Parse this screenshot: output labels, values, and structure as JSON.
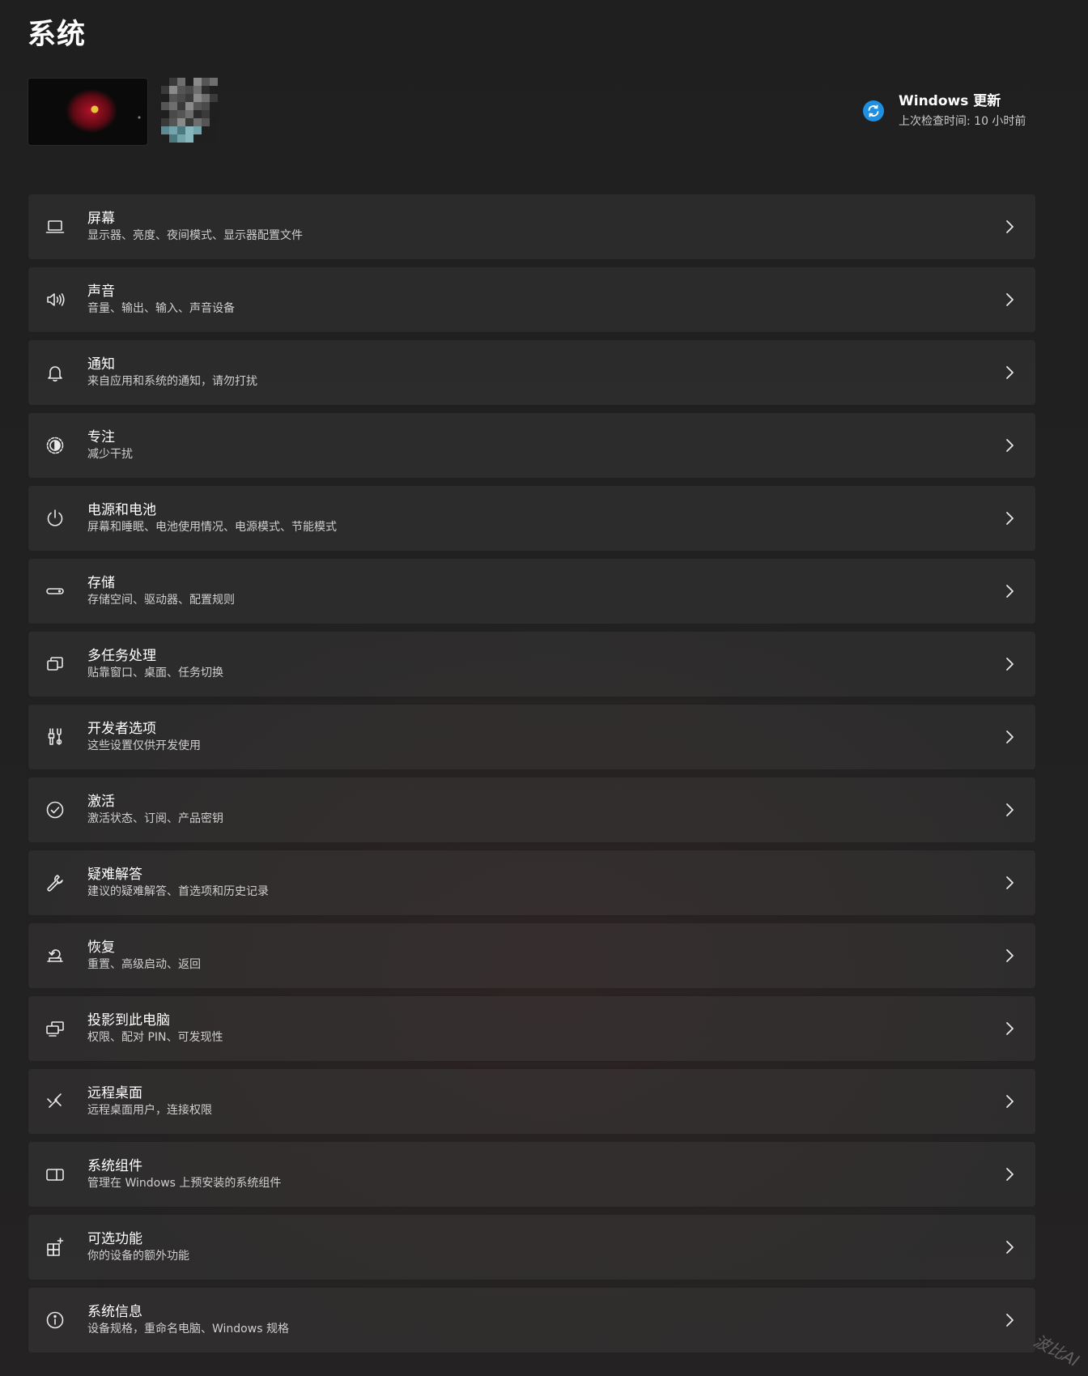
{
  "page": {
    "title": "系统"
  },
  "profile": {
    "avatar_icon": "avatar-image"
  },
  "update": {
    "title": "Windows 更新",
    "subtitle": "上次检查时间: 10 小时前",
    "icon": "sync-icon",
    "accent": "#1e8fe1"
  },
  "items": [
    {
      "title": "屏幕",
      "subtitle": "显示器、亮度、夜间模式、显示器配置文件",
      "icon": "laptop-icon"
    },
    {
      "title": "声音",
      "subtitle": "音量、输出、输入、声音设备",
      "icon": "speaker-icon"
    },
    {
      "title": "通知",
      "subtitle": "来自应用和系统的通知，请勿打扰",
      "icon": "bell-icon"
    },
    {
      "title": "专注",
      "subtitle": "减少干扰",
      "icon": "focus-icon"
    },
    {
      "title": "电源和电池",
      "subtitle": "屏幕和睡眠、电池使用情况、电源模式、节能模式",
      "icon": "power-icon"
    },
    {
      "title": "存储",
      "subtitle": "存储空间、驱动器、配置规则",
      "icon": "storage-icon"
    },
    {
      "title": "多任务处理",
      "subtitle": "贴靠窗口、桌面、任务切换",
      "icon": "multitask-icon"
    },
    {
      "title": "开发者选项",
      "subtitle": "这些设置仅供开发使用",
      "icon": "developer-tools-icon"
    },
    {
      "title": "激活",
      "subtitle": "激活状态、订阅、产品密钥",
      "icon": "check-circle-icon"
    },
    {
      "title": "疑难解答",
      "subtitle": "建议的疑难解答、首选项和历史记录",
      "icon": "wrench-icon"
    },
    {
      "title": "恢复",
      "subtitle": "重置、高级启动、返回",
      "icon": "recovery-icon"
    },
    {
      "title": "投影到此电脑",
      "subtitle": "权限、配对 PIN、可发现性",
      "icon": "project-icon"
    },
    {
      "title": "远程桌面",
      "subtitle": "远程桌面用户，连接权限",
      "icon": "remote-desktop-icon"
    },
    {
      "title": "系统组件",
      "subtitle": "管理在 Windows 上预安装的系统组件",
      "icon": "components-icon"
    },
    {
      "title": "可选功能",
      "subtitle": "你的设备的额外功能",
      "icon": "optional-features-icon"
    },
    {
      "title": "系统信息",
      "subtitle": "设备规格，重命名电脑、Windows 规格",
      "icon": "info-icon"
    }
  ],
  "watermark": "波比AI"
}
